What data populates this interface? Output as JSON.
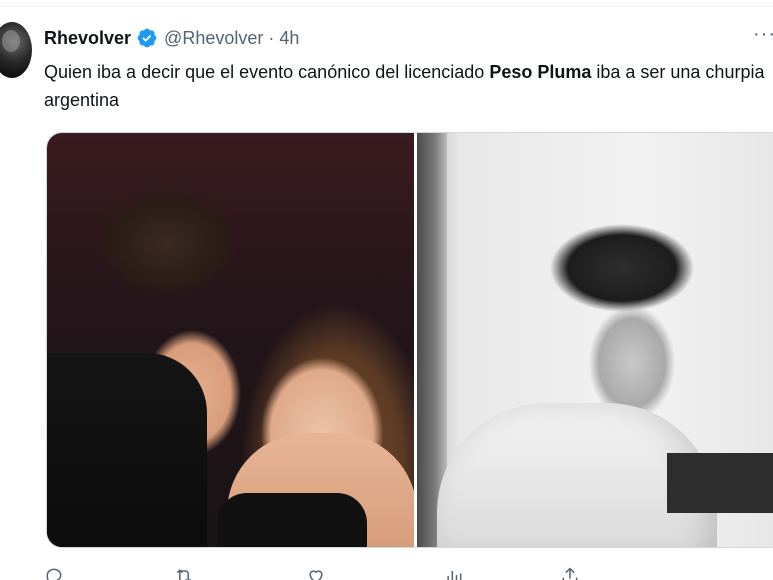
{
  "tweet": {
    "author": {
      "display_name": "Rhevolver",
      "handle": "@Rhevolver",
      "verified": true
    },
    "separator": "·",
    "time": "4h",
    "text": {
      "part1": "Quien iba a decir que el evento canónico del licenciado ",
      "bold": "Peso Pluma",
      "part2": " iba a ser una churpia argentina"
    }
  },
  "colors": {
    "text": "#0f1419",
    "secondary": "#536471",
    "verified": "#1d9bf0",
    "border": "#cfd9de"
  },
  "icons": {
    "more": "more-icon",
    "verified": "verified-badge-icon",
    "reply": "reply-icon",
    "retweet": "retweet-icon",
    "like": "like-icon",
    "views": "views-icon",
    "share": "share-icon"
  }
}
